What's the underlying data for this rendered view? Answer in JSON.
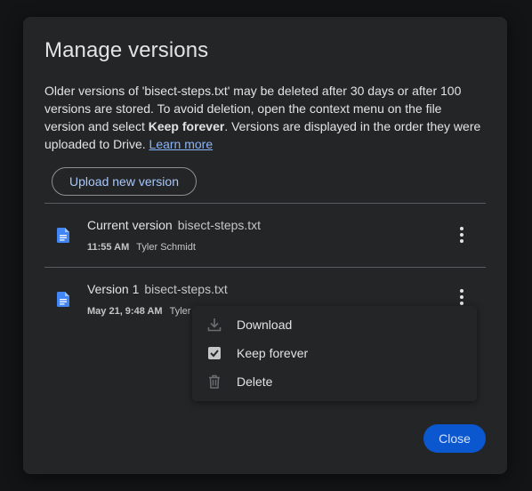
{
  "dialog": {
    "title": "Manage versions",
    "description": {
      "part1": "Older versions of 'bisect-steps.txt' may be deleted after 30 days or after 100 versions are stored. To avoid deletion, open the context menu on the file version and select ",
      "bold": "Keep forever",
      "part2": ". Versions are displayed in the order they were uploaded to Drive. ",
      "link": "Learn more"
    },
    "upload_label": "Upload new version",
    "close_label": "Close"
  },
  "versions": [
    {
      "label": "Current version",
      "filename": "bisect-steps.txt",
      "time": "11:55 AM",
      "user": "Tyler Schmidt"
    },
    {
      "label": "Version 1",
      "filename": "bisect-steps.txt",
      "time": "May 21, 9:48 AM",
      "user": "Tyler"
    }
  ],
  "context_menu": {
    "items": [
      {
        "label": "Download",
        "icon": "download-icon"
      },
      {
        "label": "Keep forever",
        "icon": "checkbox-checked-icon"
      },
      {
        "label": "Delete",
        "icon": "trash-icon"
      }
    ]
  },
  "colors": {
    "background": "#131416",
    "dialog": "#242527",
    "accent": "#0b57d0",
    "link": "#8ab4f8",
    "file_icon": "#4285f4"
  }
}
